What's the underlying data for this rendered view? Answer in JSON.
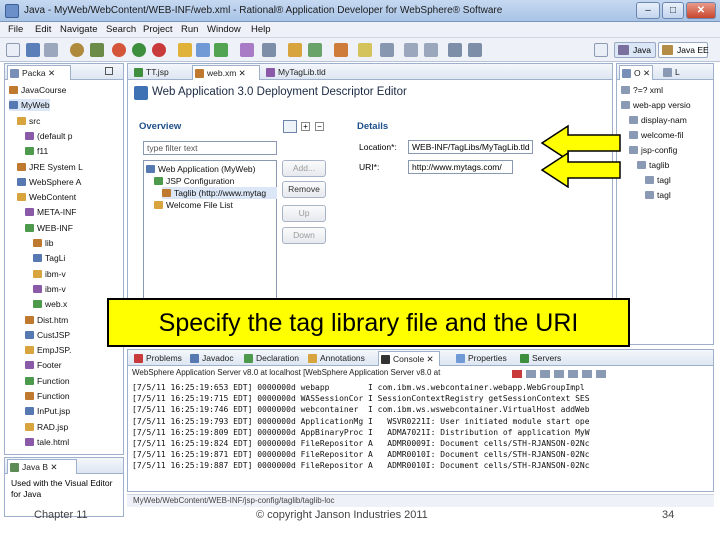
{
  "window": {
    "title": "Java - MyWeb/WebContent/WEB-INF/web.xml - Rational® Application Developer for WebSphere® Software"
  },
  "menu": [
    "File",
    "Edit",
    "Navigate",
    "Search",
    "Project",
    "Run",
    "Window",
    "Help"
  ],
  "perspectives": {
    "java": "Java",
    "java_ee": "Java EE"
  },
  "left_view": {
    "tab_label": "Packa",
    "tree": [
      {
        "label": "JavaCourse",
        "indent": 0
      },
      {
        "label": "MyWeb",
        "indent": 0,
        "selected": true
      },
      {
        "label": "src",
        "indent": 1
      },
      {
        "label": "(default p",
        "indent": 2
      },
      {
        "label": "f11",
        "indent": 2
      },
      {
        "label": "JRE System L",
        "indent": 1
      },
      {
        "label": "WebSphere A",
        "indent": 1
      },
      {
        "label": "WebContent",
        "indent": 1
      },
      {
        "label": "META-INF",
        "indent": 2
      },
      {
        "label": "WEB-INF",
        "indent": 2
      },
      {
        "label": "lib",
        "indent": 3
      },
      {
        "label": "TagLi",
        "indent": 3
      },
      {
        "label": "ibm-v",
        "indent": 3
      },
      {
        "label": "ibm-v",
        "indent": 3
      },
      {
        "label": "web.x",
        "indent": 3
      },
      {
        "label": "Dist.htm",
        "indent": 2
      },
      {
        "label": "CustJSP",
        "indent": 2
      },
      {
        "label": "EmpJSP.",
        "indent": 2
      },
      {
        "label": "Footer",
        "indent": 2
      },
      {
        "label": "Function",
        "indent": 2
      },
      {
        "label": "Function",
        "indent": 2
      },
      {
        "label": "InPut.jsp",
        "indent": 2
      },
      {
        "label": "RAD.jsp",
        "indent": 2
      },
      {
        "label": "tale.html",
        "indent": 2
      }
    ]
  },
  "bottom_left_view": {
    "tab_label": "Java B",
    "text_lines": [
      "Used with the Visual Editor",
      "for Java"
    ]
  },
  "editor_tabs": [
    "TT.jsp",
    "web.xm",
    "MyTagLib.tld"
  ],
  "editor": {
    "header": "Web Application 3.0 Deployment Descriptor Editor",
    "overview": {
      "title": "Overview",
      "filter_placeholder": "type filter text",
      "tree": [
        {
          "label": "Web Application (MyWeb)",
          "indent": 0
        },
        {
          "label": "JSP Configuration",
          "indent": 1
        },
        {
          "label": "Taglib (http://www.mytag",
          "indent": 2,
          "selected": true
        },
        {
          "label": "Welcome File List",
          "indent": 1
        }
      ],
      "buttons": {
        "add": "Add...",
        "remove": "Remove",
        "up": "Up",
        "down": "Down"
      }
    },
    "details": {
      "title": "Details",
      "location_label": "Location*:",
      "location_value": "WEB-INF/TagLibs/MyTagLib.tld",
      "uri_label": "URI*:",
      "uri_value": "http://www.mytags.com/"
    }
  },
  "outline": {
    "tab_label": "O",
    "tab2_label": "L",
    "tree": [
      {
        "label": "?=? xml",
        "indent": 0
      },
      {
        "label": "web-app versio",
        "indent": 0
      },
      {
        "label": "display-nam",
        "indent": 1
      },
      {
        "label": "welcome-fil",
        "indent": 1
      },
      {
        "label": "jsp-config",
        "indent": 1
      },
      {
        "label": "taglib",
        "indent": 2
      },
      {
        "label": "tagl",
        "indent": 3
      },
      {
        "label": "tagl",
        "indent": 3
      }
    ]
  },
  "bottom_tabs": [
    "Problems",
    "Javadoc",
    "Declaration",
    "Annotations",
    "Console",
    "Properties",
    "Servers"
  ],
  "console": {
    "header": "WebSphere Application Server v8.0 at localhost [WebSphere Application Server v8.0 at",
    "lines": [
      "[7/5/11 16:25:19:653 EDT] 0000000d webapp        I com.ibm.ws.webcontainer.webapp.WebGroupImpl",
      "[7/5/11 16:25:19:715 EDT] 0000000d WASSessionCor I SessionContextRegistry getSessionContext SES",
      "[7/5/11 16:25:19:746 EDT] 0000000d webcontainer  I com.ibm.ws.wswebcontainer.VirtualHost addWeb",
      "[7/5/11 16:25:19:793 EDT] 0000000d ApplicationMg I   WSVR0221I: User initiated module start ope",
      "[7/5/11 16:25:19:809 EDT] 0000000d AppBinaryProc I   ADMA7021I: Distribution of application MyW",
      "[7/5/11 16:25:19:824 EDT] 0000000d FileRepositor A   ADMR0009I: Document cells/STH-RJANSON-02Nc",
      "[7/5/11 16:25:19:871 EDT] 0000000d FileRepositor A   ADMR0010I: Document cells/STH-RJANSON-02Nc",
      "[7/5/11 16:25:19:887 EDT] 0000000d FileRepositor A   ADMR0010I: Document cells/STH-RJANSON-02Nc"
    ]
  },
  "statusbar": {
    "path": "MyWeb/WebContent/WEB-INF/jsp-config/taglib/taglib-loc"
  },
  "callout": {
    "text": "Specify the tag library file and the URI"
  },
  "slide_footer": {
    "left": "Chapter 11",
    "center": "© copyright Janson Industries 2011",
    "page": "34"
  },
  "colors": {
    "callout_bg": "#ffff00",
    "arrow_fill": "#ffff00",
    "accent": "#1d4f8a"
  }
}
